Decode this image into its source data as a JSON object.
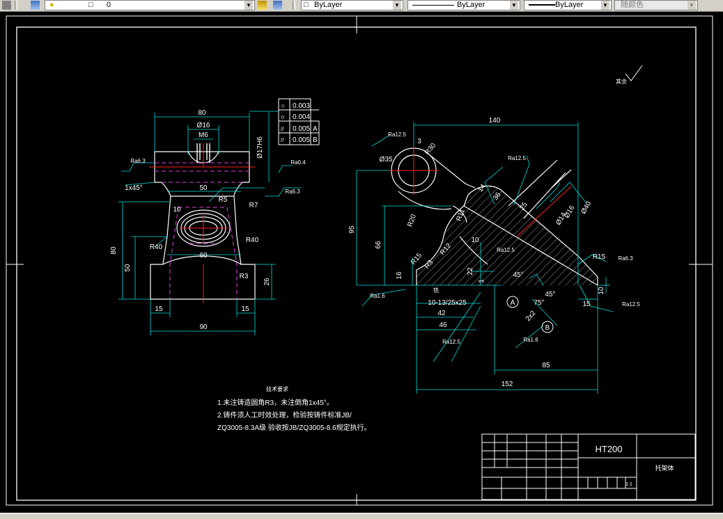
{
  "toolbar": {
    "layer_value": "0",
    "color_value": "ByLayer",
    "linetype_value": "ByLayer",
    "lineweight_value": "ByLayer",
    "plotstyle_value": "随颜色"
  },
  "drawing": {
    "dims_left": {
      "d80_top": "80",
      "d16": "Ø16",
      "m6": "M6",
      "d17h6": "Ø17H6",
      "ra63_l": "Ra6.3",
      "ra04": "Ra0.4",
      "chamfer": "1x45°",
      "d50": "50",
      "ra63_b": "Ra6.3",
      "r5": "R5",
      "r7": "R7",
      "d10": "10",
      "r40_l": "R40",
      "r40_r": "R40",
      "d60": "60",
      "h80": "80",
      "h50": "50",
      "r3": "R3",
      "h26": "26",
      "d15_l": "15",
      "d15_r": "15",
      "d90": "90"
    },
    "tolerance_frame": [
      {
        "sym": "○",
        "val": "0.003",
        "ref": ""
      },
      {
        "sym": "⌭",
        "val": "0.004",
        "ref": ""
      },
      {
        "sym": "//",
        "val": "0.005",
        "ref": "A"
      },
      {
        "sym": "//",
        "val": "0.005",
        "ref": "B"
      }
    ],
    "dims_right": {
      "ra125_top": "Ra12.5",
      "d140": "140",
      "r30": "R30",
      "d35": "Ø35",
      "d3": "3",
      "ra125_mid": "Ra12.5",
      "d14": "14",
      "d36": "36",
      "d25": "25",
      "d16": "Ø16",
      "d40": "Ø40",
      "d14b": "Ø14",
      "r20": "R20",
      "r11": "R11",
      "r12": "R12",
      "r15": "R15",
      "h95": "95",
      "h66": "66",
      "d10": "10",
      "ra125_c": "Ra12.5",
      "r3": "R3",
      "h22": "22",
      "a45a": "45°",
      "a75": "75°",
      "a45b": "45°",
      "d1": "1",
      "h16": "16",
      "ra63_r": "Ra6.3",
      "d10r": "10",
      "ra16_l": "Ra1.6",
      "slot_label": "铣",
      "slot": "10-13/25x25",
      "datum_a": "A",
      "chamfer2": "2x2",
      "datum_b": "B",
      "d42": "42",
      "d15": "15",
      "ra125_r": "Ra12.5",
      "d46": "46",
      "ra125_b": "Ra12.5",
      "ra16_b": "Ra1.6",
      "d85": "85",
      "d152": "152"
    },
    "rough_note": "其余",
    "notes": {
      "title": "技术要求",
      "line1": "1.未注铸造圆角R3，未注倒角1x45°。",
      "line2": "2.铸件须人工时效处理，检验按铸件标准JB/",
      "line3": "ZQ3005-8.3A级 验收按JB/ZQ3005-8.6规定执行。"
    },
    "title_block": {
      "material": "HT200",
      "part_name": "托架体",
      "scale": "1:1"
    }
  }
}
